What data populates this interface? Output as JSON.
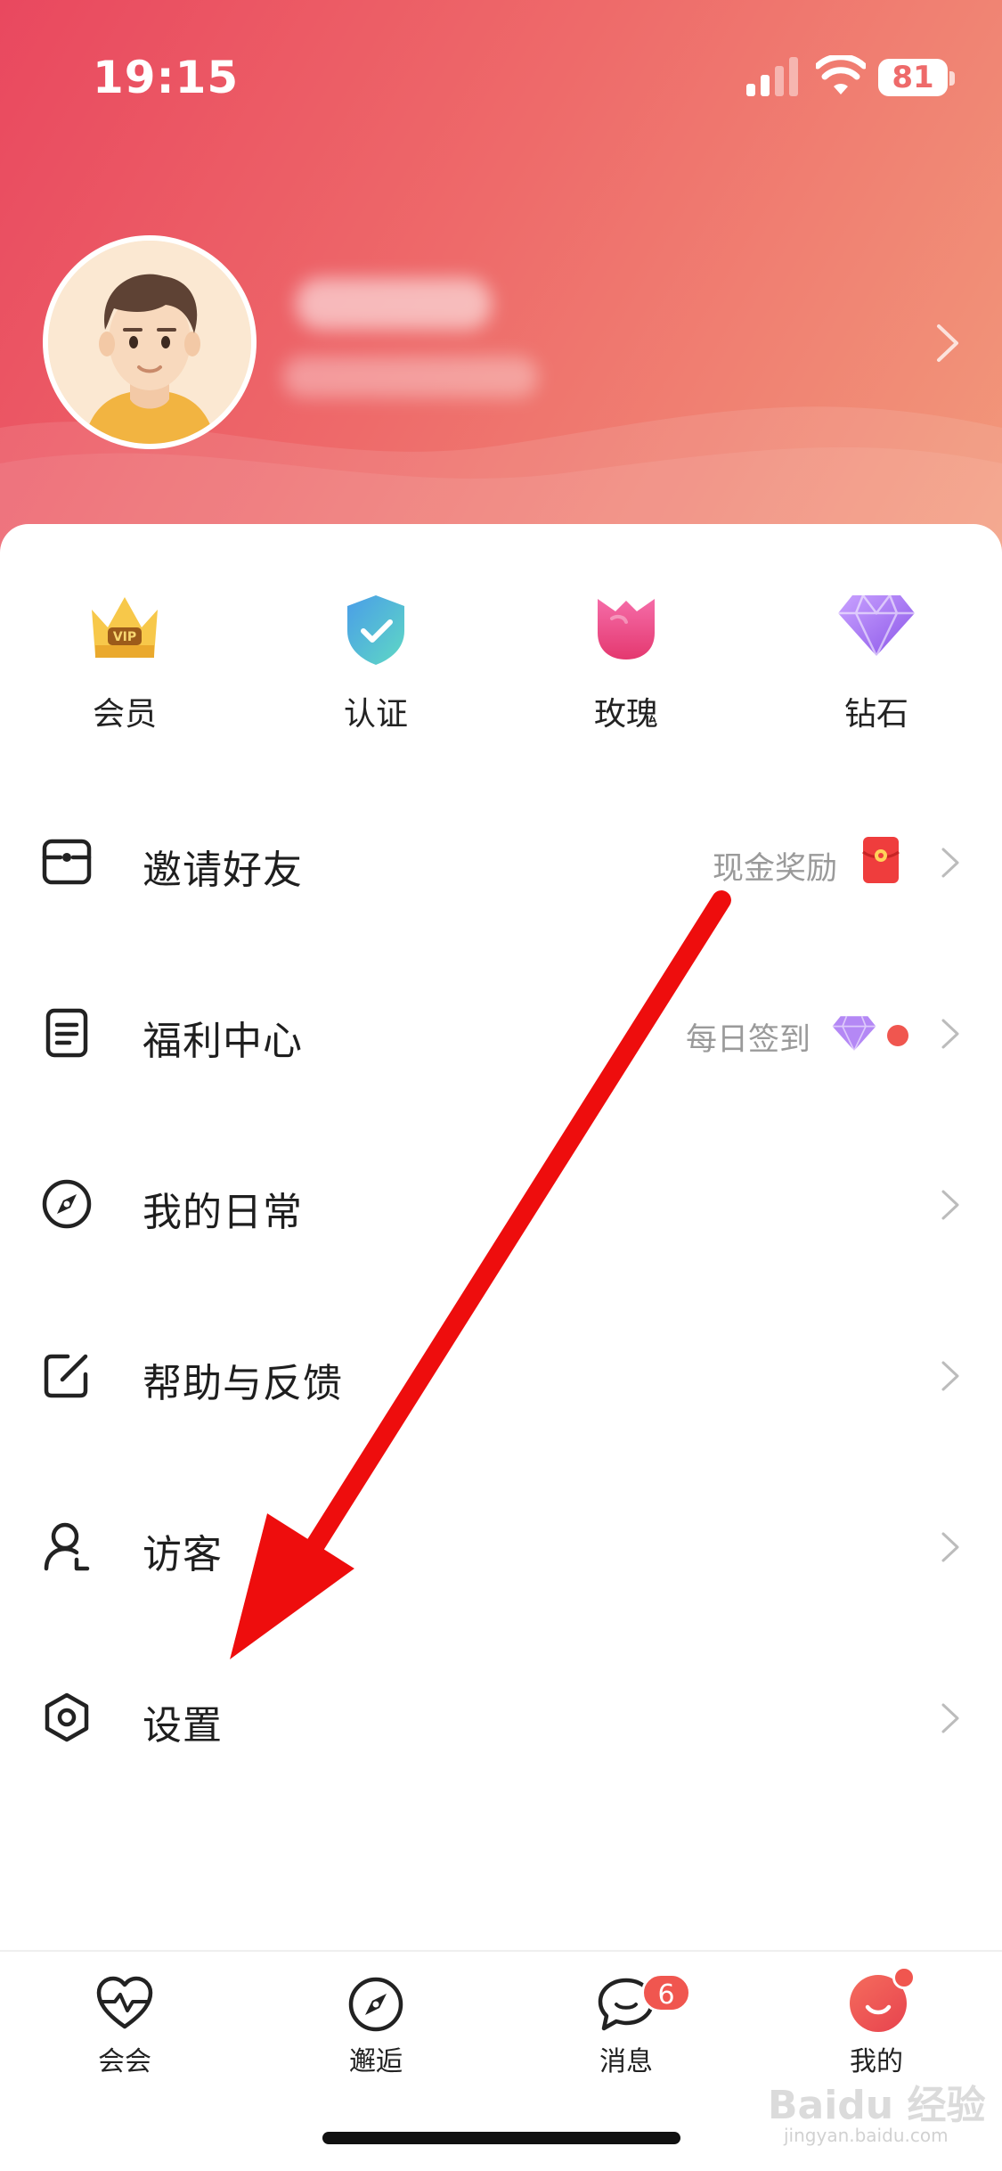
{
  "status_bar": {
    "time": "19:15",
    "battery": "81"
  },
  "quick_actions": [
    {
      "label": "会员",
      "icon": "vip-crown-icon"
    },
    {
      "label": "认证",
      "icon": "verified-shield-icon"
    },
    {
      "label": "玫瑰",
      "icon": "rose-icon"
    },
    {
      "label": "钻石",
      "icon": "diamond-icon"
    }
  ],
  "menu": [
    {
      "label": "邀请好友",
      "extra": "现金奖励",
      "icon": "invite-icon"
    },
    {
      "label": "福利中心",
      "extra": "每日签到",
      "icon": "document-icon"
    },
    {
      "label": "我的日常",
      "extra": "",
      "icon": "compass-icon"
    },
    {
      "label": "帮助与反馈",
      "extra": "",
      "icon": "edit-icon"
    },
    {
      "label": "访客",
      "extra": "",
      "icon": "visitor-icon"
    },
    {
      "label": "设置",
      "extra": "",
      "icon": "settings-hexagon-icon"
    }
  ],
  "tabs": [
    {
      "label": "会会",
      "icon": "heart-pulse-icon"
    },
    {
      "label": "邂逅",
      "icon": "compass-icon"
    },
    {
      "label": "消息",
      "icon": "chat-bubble-icon",
      "badge": "6"
    },
    {
      "label": "我的",
      "icon": "me-avatar-icon"
    }
  ],
  "colors": {
    "header_gradient_start": "#e9485f",
    "header_gradient_end": "#f29a7b",
    "accent_red": "#f0564f",
    "arrow_red": "#ee1111"
  },
  "watermark": {
    "brand": "Baidu 经验",
    "url": "jingyan.baidu.com"
  }
}
